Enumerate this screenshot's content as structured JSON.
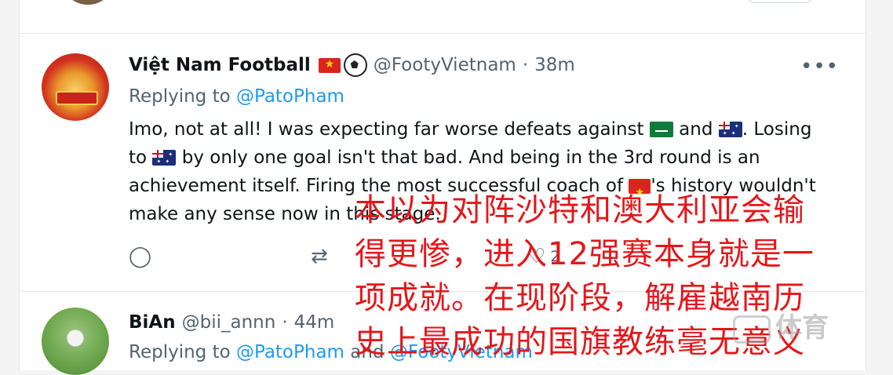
{
  "tweet1": {
    "name": "Việt Nam Football",
    "handle": "@FootyVietnam",
    "separator": "·",
    "time": "38m",
    "replying_prefix": "Replying to",
    "replying_to": "@PatoPham",
    "text_a": "Imo, not at all! I was expecting far worse defeats against",
    "text_b": "and",
    "text_c": ". Losing",
    "text_d": "to",
    "text_e": "by only one goal isn't that bad. And being in the 3rd round is an achievement itself. Firing the most successful coach of",
    "text_f": "'s history wouldn't make any sense now in this stage.",
    "actions": {
      "reply_icon": "reply-icon",
      "retweet_icon": "retweet-icon",
      "like_count": "2"
    }
  },
  "tweet2": {
    "name": "BiAn",
    "handle": "@bii_annn",
    "separator": "·",
    "time": "44m",
    "replying_prefix": "Replying to",
    "replying_to": "@PatoPham",
    "replying_and": "and",
    "replying_to_2": "@FootyVietnam"
  },
  "overlay": {
    "lines": [
      "本以为对阵沙特和澳大利亚会输",
      "得更惨，进入12强赛本身就是一",
      "项成就。在现阶段，解雇越南历",
      "史上最成功的国旗教练毫无意义"
    ],
    "color": "#e3171b"
  },
  "watermark": {
    "text": "体育"
  },
  "colors": {
    "link": "#1d9bf0",
    "muted": "#536471"
  }
}
